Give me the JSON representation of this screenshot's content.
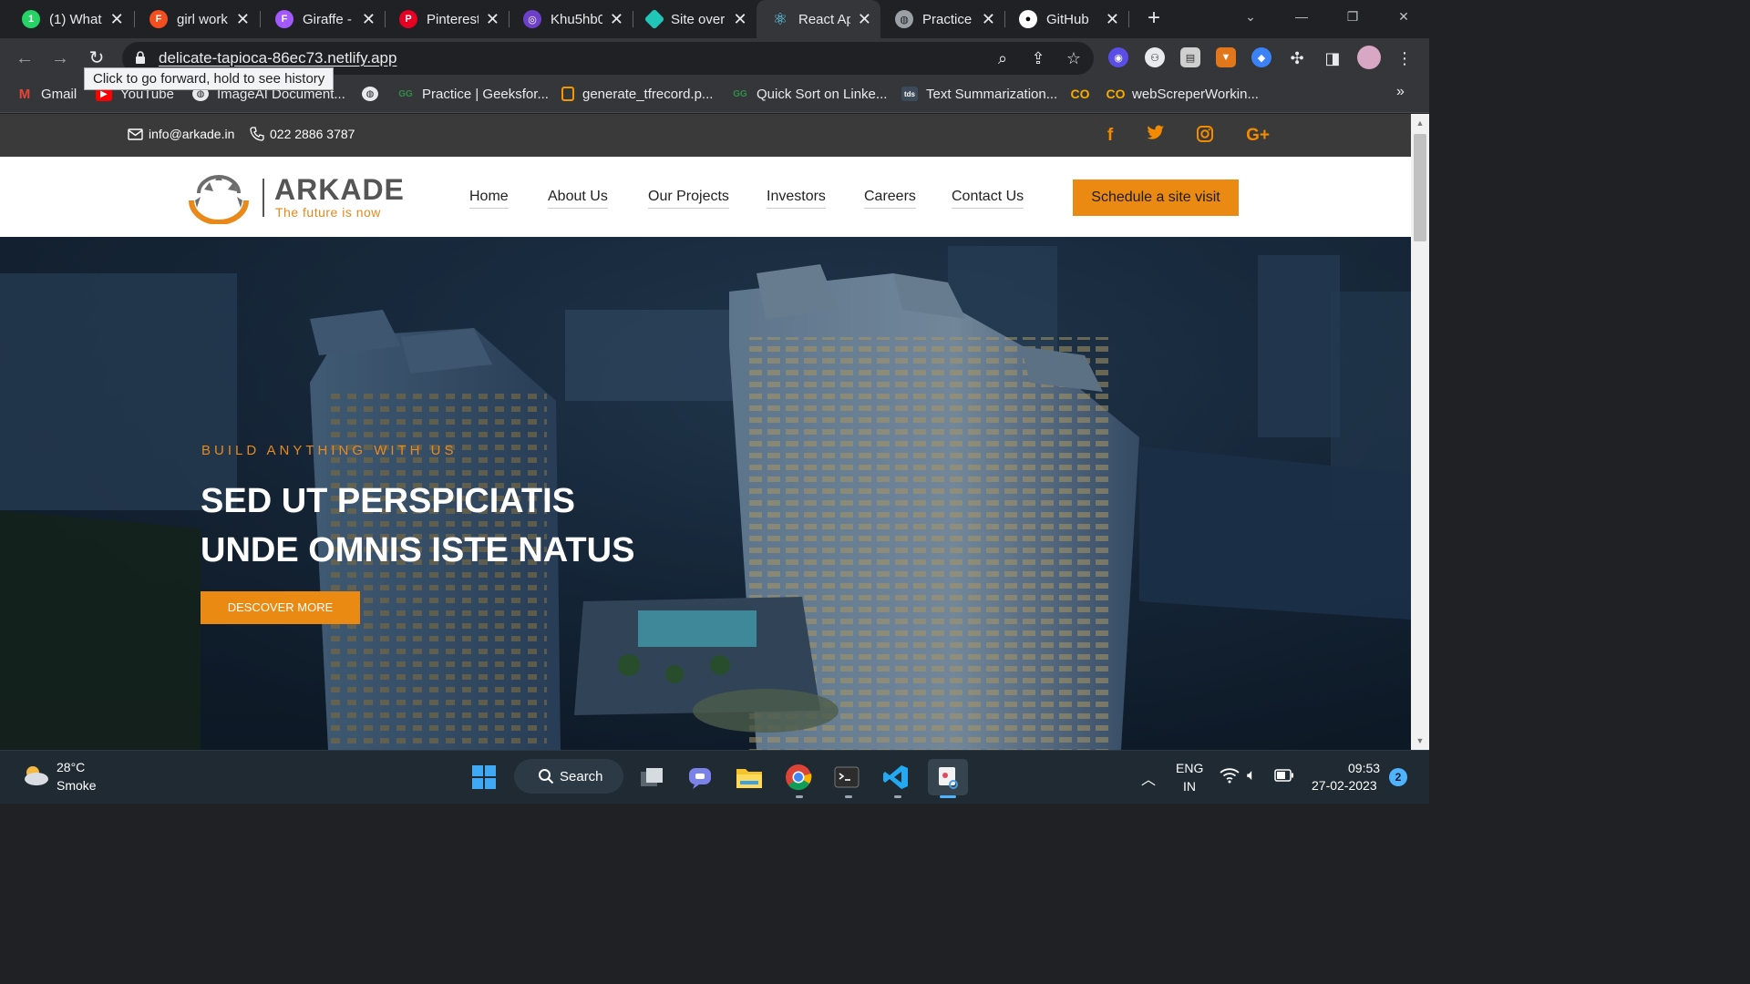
{
  "browser": {
    "tabs": [
      {
        "label": "(1) What",
        "icon": "whatsapp-icon",
        "color": "#25d366"
      },
      {
        "label": "girl work",
        "icon": "figma-icon",
        "color": "#f24e1e"
      },
      {
        "label": "Giraffe -",
        "icon": "figma-icon",
        "color": "#a259ff"
      },
      {
        "label": "Pinterest",
        "icon": "pinterest-icon",
        "color": "#e60023"
      },
      {
        "label": "Khu5hb0",
        "icon": "github-copilot-icon",
        "color": "#6e40c9"
      },
      {
        "label": "Site over",
        "icon": "netlify-icon",
        "color": "#20c6b7"
      },
      {
        "label": "React Ap",
        "icon": "react-icon",
        "color": "#61dafb"
      },
      {
        "label": "Practice",
        "icon": "globe-icon",
        "color": "#9aa0a6"
      },
      {
        "label": "GitHub",
        "icon": "github-icon",
        "color": "#ffffff"
      }
    ],
    "url": "delicate-tapioca-86ec73.netlify.app",
    "tooltip": "Click to go forward, hold to see history",
    "bookmarks": [
      {
        "label": "Gmail",
        "icon": "gmail-icon"
      },
      {
        "label": "YouTube",
        "icon": "youtube-icon"
      },
      {
        "label": "ImageAI Document...",
        "icon": "globe-icon"
      },
      {
        "label": "",
        "icon": "globe-icon"
      },
      {
        "label": "Practice | Geeksfor...",
        "icon": "geeksforgeeks-icon"
      },
      {
        "label": "generate_tfrecord.p...",
        "icon": "file-icon"
      },
      {
        "label": "Quick Sort on Linke...",
        "icon": "geeksforgeeks-icon"
      },
      {
        "label": "Text Summarization...",
        "icon": "tds-icon"
      },
      {
        "label": "",
        "icon": "colab-icon"
      },
      {
        "label": "webScreperWorkin...",
        "icon": "colab-icon"
      }
    ],
    "bookmarks_more": "»"
  },
  "site": {
    "email": "info@arkade.in",
    "phone": "022 2886 3787",
    "logo": {
      "name": "ARKADE",
      "tagline": "The future is now"
    },
    "nav": [
      "Home",
      "About Us",
      "Our Projects",
      "Investors",
      "Careers",
      "Contact Us"
    ],
    "cta": "Schedule a site visit",
    "social": [
      "f",
      "twitter",
      "instagram",
      "G+"
    ],
    "hero": {
      "kicker": "BUILD ANYTHING WITH US",
      "title_line1": "SED UT PERSPICIATIS",
      "title_line2": "UNDE OMNIS ISTE NATUS",
      "button": "DESCOVER MORE"
    },
    "accent": "#ea8a12"
  },
  "taskbar": {
    "temp": "28°C",
    "condition": "Smoke",
    "search": "Search",
    "lang1": "ENG",
    "lang2": "IN",
    "time": "09:53",
    "date": "27-02-2023",
    "notifications": "2"
  }
}
